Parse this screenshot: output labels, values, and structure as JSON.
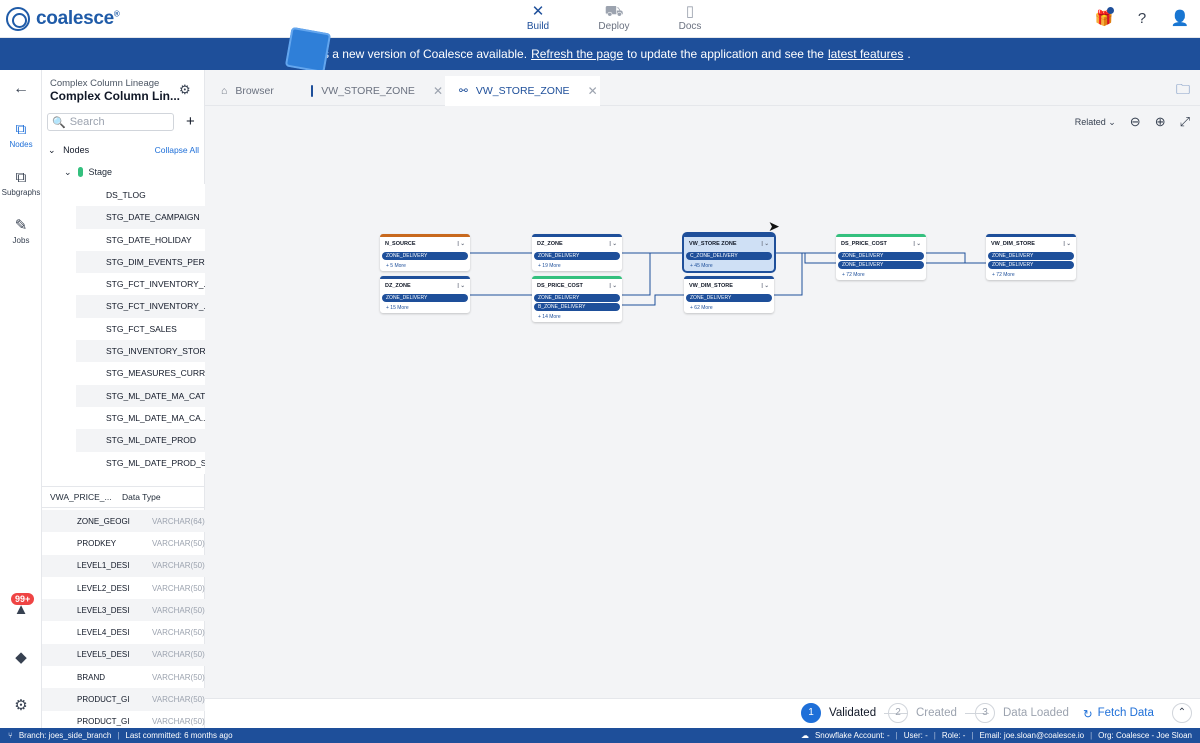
{
  "app": {
    "name": "coalesce",
    "reg": "®"
  },
  "nav": [
    {
      "label": "Build",
      "icon": "build-icon",
      "glyph": "✕"
    },
    {
      "label": "Deploy",
      "icon": "deploy-icon",
      "glyph": "⛟"
    },
    {
      "label": "Docs",
      "icon": "docs-icon",
      "glyph": "▯"
    }
  ],
  "banner": {
    "pre": "There's a new version of Coalesce available.",
    "link1": "Refresh the page",
    "mid": "to update the application and see the",
    "link2": "latest features",
    "post": "."
  },
  "rail": {
    "nodes": "Nodes",
    "subgraphs": "Subgraphs",
    "jobs": "Jobs",
    "badge": "99+"
  },
  "project": {
    "subtitle": "Complex Column Lineage",
    "title": "Complex Column Lin..."
  },
  "search": {
    "placeholder": "Search"
  },
  "tree": {
    "header": "Nodes",
    "collapse": "Collapse All",
    "group": "Stage",
    "items": [
      "DS_TLOG",
      "STG_DATE_CAMPAIGN",
      "STG_DATE_HOLIDAY",
      "STG_DIM_EVENTS_PERI...",
      "STG_FCT_INVENTORY_...",
      "STG_FCT_INVENTORY_...",
      "STG_FCT_SALES",
      "STG_INVENTORY_STOR...",
      "STG_MEASURES_CURR...",
      "STG_ML_DATE_MA_CAT",
      "STG_ML_DATE_MA_CA...",
      "STG_ML_DATE_PROD",
      "STG_ML_DATE_PROD_S..."
    ]
  },
  "columns": {
    "header_name": "VWA_PRICE_...",
    "header_type": "Data Type",
    "rows": [
      {
        "name": "ZONE_GEOGI",
        "type": "VARCHAR(64)"
      },
      {
        "name": "PRODKEY",
        "type": "VARCHAR(50)"
      },
      {
        "name": "LEVEL1_DESI",
        "type": "VARCHAR(50)"
      },
      {
        "name": "LEVEL2_DESI",
        "type": "VARCHAR(50)"
      },
      {
        "name": "LEVEL3_DESI",
        "type": "VARCHAR(50)"
      },
      {
        "name": "LEVEL4_DESI",
        "type": "VARCHAR(50)"
      },
      {
        "name": "LEVEL5_DESI",
        "type": "VARCHAR(50)"
      },
      {
        "name": "BRAND",
        "type": "VARCHAR(50)"
      },
      {
        "name": "PRODUCT_GI",
        "type": "VARCHAR(50)"
      },
      {
        "name": "PRODUCT_GI",
        "type": "VARCHAR(50)"
      }
    ]
  },
  "tabs": [
    {
      "label": "Browser"
    },
    {
      "label": "VW_STORE_ZONE"
    },
    {
      "label": "VW_STORE_ZONE"
    }
  ],
  "toolbar": {
    "related": "Related"
  },
  "graph": {
    "nodes": [
      {
        "title": "N_SOURCE",
        "cols": [
          "ZONE_DELIVERY"
        ],
        "more": "+ 5 More",
        "color": "#c8691e"
      },
      {
        "title": "DZ_ZONE",
        "cols": [
          "ZONE_DELIVERY"
        ],
        "more": "+ 15 More",
        "color": "#1e4f9a"
      },
      {
        "title": "DZ_ZONE",
        "cols": [
          "ZONE_DELIVERY"
        ],
        "more": "+ 19 More",
        "color": "#1e4f9a"
      },
      {
        "title": "DS_PRICE_COST",
        "cols": [
          "ZONE_DELIVERY",
          "B_ZONE_DELIVERY"
        ],
        "more": "+ 14 More",
        "color": "#34c07e"
      },
      {
        "title": "VW_STORE ZONE",
        "cols": [
          "C_ZONE_DELIVERY"
        ],
        "more": "+ 45 More",
        "color": "#1e4f9a"
      },
      {
        "title": "VW_DIM_STORE",
        "cols": [
          "ZONE_DELIVERY"
        ],
        "more": "+ 62 More",
        "color": "#1e4f9a"
      },
      {
        "title": "DS_PRICE_COST",
        "cols": [
          "ZONE_DELIVERY",
          "ZONE_DELIVERY"
        ],
        "more": "+ 72 More",
        "color": "#34c07e"
      },
      {
        "title": "VW_DIM_STORE",
        "cols": [
          "ZONE_DELIVERY",
          "ZONE_DELIVERY"
        ],
        "more": "+ 72 More",
        "color": "#1e4f9a"
      }
    ]
  },
  "steps": {
    "s1": "Validated",
    "s2": "Created",
    "s3": "Data Loaded",
    "fetch": "Fetch Data"
  },
  "status": {
    "branch": "Branch: joes_side_branch",
    "commit": "Last committed: 6 months ago",
    "account": "Snowflake Account: -",
    "user": "User: -",
    "role": "Role: -",
    "email": "Email: joe.sloan@coalesce.io",
    "org": "Org: Coalesce - Joe Sloan"
  }
}
